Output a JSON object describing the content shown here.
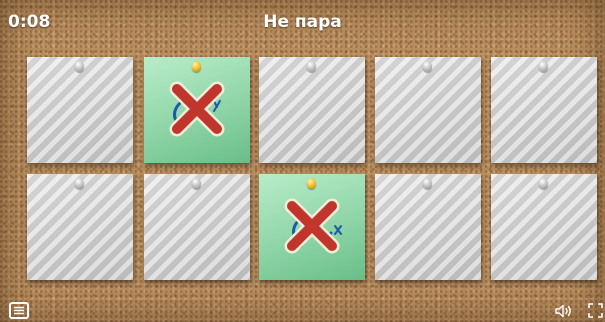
{
  "header": {
    "timer": "0:08",
    "status": "Не пара"
  },
  "game": {
    "type": "memory-pairs",
    "rows": 2,
    "columns": 5,
    "cards": [
      {
        "row": 1,
        "col": 1,
        "state": "face-down",
        "pin": "silver"
      },
      {
        "row": 1,
        "col": 2,
        "state": "revealed-mismatch",
        "pin": "gold",
        "mark": "red-x"
      },
      {
        "row": 1,
        "col": 3,
        "state": "face-down",
        "pin": "silver"
      },
      {
        "row": 1,
        "col": 4,
        "state": "face-down",
        "pin": "silver"
      },
      {
        "row": 1,
        "col": 5,
        "state": "face-down",
        "pin": "silver"
      },
      {
        "row": 2,
        "col": 1,
        "state": "face-down",
        "pin": "silver"
      },
      {
        "row": 2,
        "col": 2,
        "state": "face-down",
        "pin": "silver"
      },
      {
        "row": 2,
        "col": 3,
        "state": "revealed-mismatch",
        "pin": "gold",
        "mark": "red-x"
      },
      {
        "row": 2,
        "col": 4,
        "state": "face-down",
        "pin": "silver"
      },
      {
        "row": 2,
        "col": 5,
        "state": "face-down",
        "pin": "silver"
      }
    ]
  },
  "footer": {
    "menu_icon": "menu-icon",
    "sound_icon": "speaker-icon",
    "fullscreen_icon": "fullscreen-icon"
  },
  "colors": {
    "board": "#b98e5f",
    "card_back": "#d2d2d2",
    "card_revealed": "#84d8a2",
    "mismatch_mark": "#c0362c",
    "header_text": "#ffffff"
  }
}
